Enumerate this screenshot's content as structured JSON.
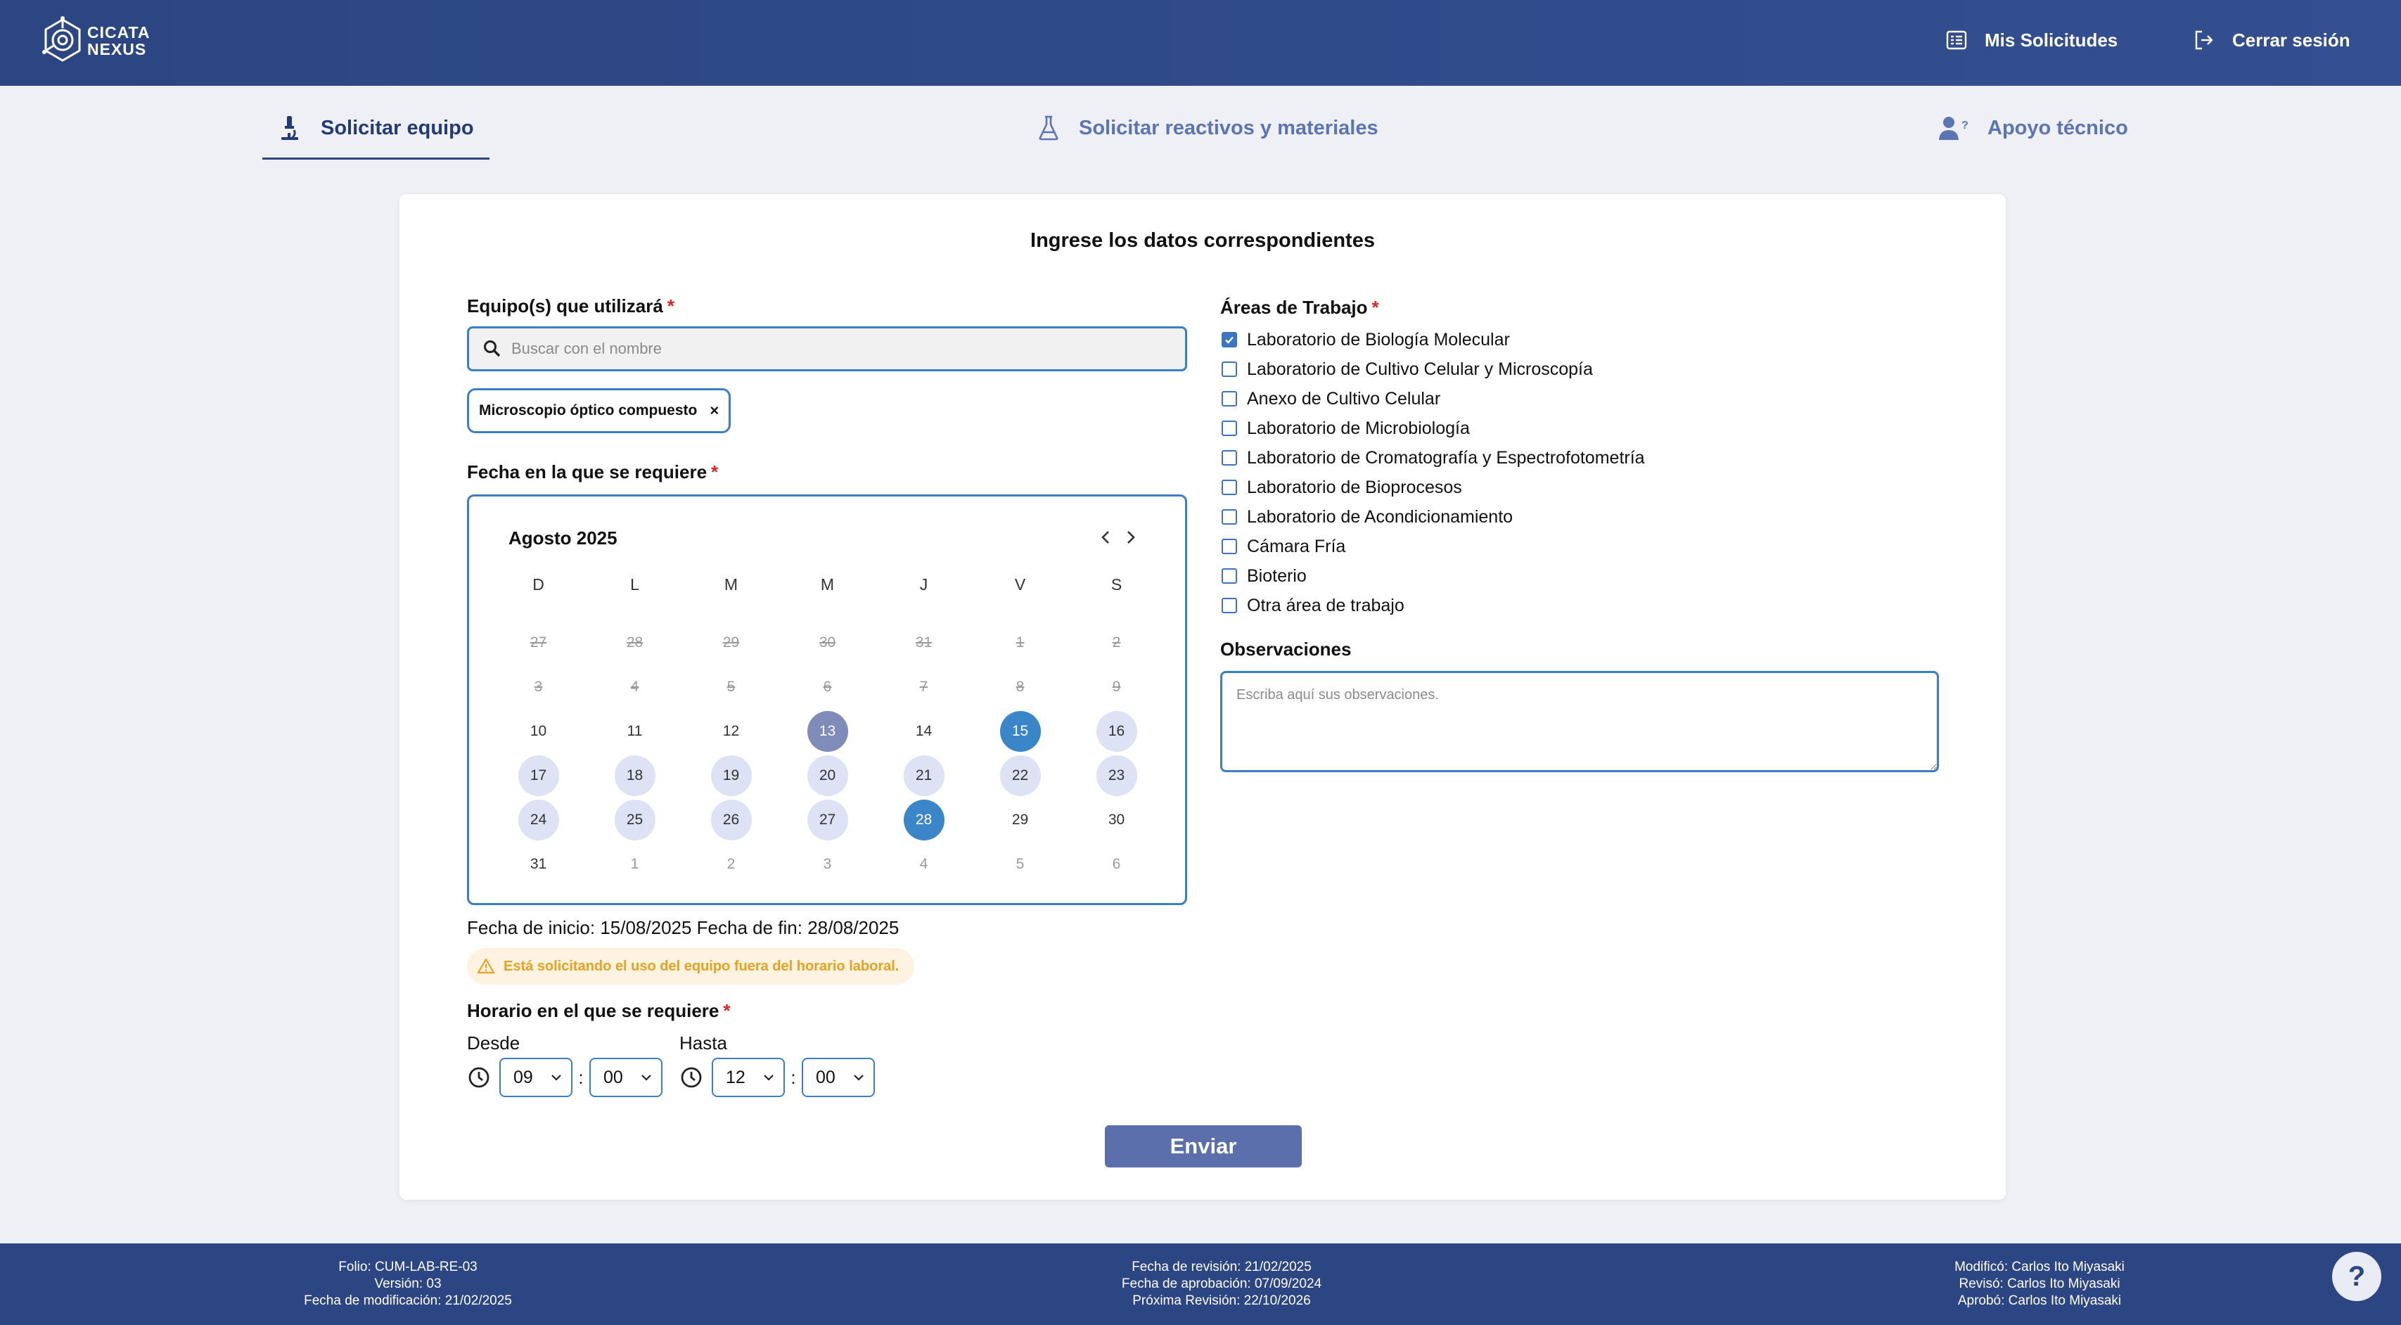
{
  "header": {
    "logo_line1": "CICATA",
    "logo_line2": "NEXUS",
    "my_requests": "Mis Solicitudes",
    "logout": "Cerrar sesión"
  },
  "tabs": [
    {
      "label": "Solicitar equipo",
      "icon": "microscope-icon",
      "active": true
    },
    {
      "label": "Solicitar reactivos y materiales",
      "icon": "flask-icon",
      "active": false
    },
    {
      "label": "Apoyo técnico",
      "icon": "user-help-icon",
      "active": false
    }
  ],
  "form": {
    "title": "Ingrese los datos correspondientes",
    "equipment_label": "Equipo(s) que utilizará",
    "required_mark": "*",
    "search_placeholder": "Buscar con el nombre",
    "selected_equipment": "Microscopio óptico compuesto",
    "chip_remove": "×",
    "date_label": "Fecha en la que se requiere",
    "calendar": {
      "month": "Agosto 2025",
      "weekdays": [
        "D",
        "L",
        "M",
        "M",
        "J",
        "V",
        "S"
      ],
      "weeks": [
        [
          {
            "d": "27",
            "s": "disabled"
          },
          {
            "d": "28",
            "s": "disabled"
          },
          {
            "d": "29",
            "s": "disabled"
          },
          {
            "d": "30",
            "s": "disabled"
          },
          {
            "d": "31",
            "s": "disabled"
          },
          {
            "d": "1",
            "s": "disabled"
          },
          {
            "d": "2",
            "s": "disabled"
          }
        ],
        [
          {
            "d": "3",
            "s": "disabled"
          },
          {
            "d": "4",
            "s": "disabled"
          },
          {
            "d": "5",
            "s": "disabled"
          },
          {
            "d": "6",
            "s": "disabled"
          },
          {
            "d": "7",
            "s": "disabled"
          },
          {
            "d": "8",
            "s": "disabled"
          },
          {
            "d": "9",
            "s": "disabled"
          }
        ],
        [
          {
            "d": "10",
            "s": "normal"
          },
          {
            "d": "11",
            "s": "normal"
          },
          {
            "d": "12",
            "s": "normal"
          },
          {
            "d": "13",
            "s": "today"
          },
          {
            "d": "14",
            "s": "normal"
          },
          {
            "d": "15",
            "s": "selected"
          },
          {
            "d": "16",
            "s": "range"
          }
        ],
        [
          {
            "d": "17",
            "s": "range"
          },
          {
            "d": "18",
            "s": "range"
          },
          {
            "d": "19",
            "s": "range"
          },
          {
            "d": "20",
            "s": "range"
          },
          {
            "d": "21",
            "s": "range"
          },
          {
            "d": "22",
            "s": "range"
          },
          {
            "d": "23",
            "s": "range"
          }
        ],
        [
          {
            "d": "24",
            "s": "range"
          },
          {
            "d": "25",
            "s": "range"
          },
          {
            "d": "26",
            "s": "range"
          },
          {
            "d": "27",
            "s": "range"
          },
          {
            "d": "28",
            "s": "selected"
          },
          {
            "d": "29",
            "s": "normal"
          },
          {
            "d": "30",
            "s": "normal"
          }
        ],
        [
          {
            "d": "31",
            "s": "normal"
          },
          {
            "d": "1",
            "s": "outside"
          },
          {
            "d": "2",
            "s": "outside"
          },
          {
            "d": "3",
            "s": "outside"
          },
          {
            "d": "4",
            "s": "outside"
          },
          {
            "d": "5",
            "s": "outside"
          },
          {
            "d": "6",
            "s": "outside"
          }
        ]
      ]
    },
    "dates_summary": "Fecha de inicio: 15/08/2025 Fecha de fin: 28/08/2025",
    "warning": "Está solicitando el uso del equipo fuera del horario laboral.",
    "schedule_label": "Horario en el que se requiere",
    "from_label": "Desde",
    "to_label": "Hasta",
    "from_hour": "09",
    "from_minute": "00",
    "to_hour": "12",
    "to_minute": "00",
    "time_separator": ":",
    "submit": "Enviar",
    "areas_label": "Áreas de Trabajo",
    "areas": [
      {
        "label": "Laboratorio de Biología Molecular",
        "checked": true
      },
      {
        "label": "Laboratorio de Cultivo Celular y Microscopía",
        "checked": false
      },
      {
        "label": "Anexo de Cultivo Celular",
        "checked": false
      },
      {
        "label": "Laboratorio de Microbiología",
        "checked": false
      },
      {
        "label": "Laboratorio de Cromatografía y Espectrofotometría",
        "checked": false
      },
      {
        "label": "Laboratorio de Bioprocesos",
        "checked": false
      },
      {
        "label": "Laboratorio de Acondicionamiento",
        "checked": false
      },
      {
        "label": "Cámara Fría",
        "checked": false
      },
      {
        "label": "Bioterio",
        "checked": false
      },
      {
        "label": "Otra área de trabajo",
        "checked": false
      }
    ],
    "observations_label": "Observaciones",
    "observations_placeholder": "Escriba aquí sus observaciones."
  },
  "footer": {
    "folio": "Folio: CUM-LAB-RE-03",
    "version": "Versión: 03",
    "modified_date": "Fecha de modificación: 21/02/2025",
    "review_date": "Fecha de revisión: 21/02/2025",
    "approval_date": "Fecha de aprobación: 07/09/2024",
    "next_review": "Próxima Revisión: 22/10/2026",
    "modified_by": "Modificó: Carlos Ito Miyasaki",
    "reviewed_by": "Revisó: Carlos Ito Miyasaki",
    "approved_by": "Aprobó: Carlos Ito Miyasaki"
  },
  "help_label": "?",
  "colors": {
    "header": "#2c4683",
    "accent": "#3a86c8",
    "range": "#dde3f5",
    "today": "#7f8bb8",
    "warning": "#e8a120",
    "submit": "#5a6fac"
  }
}
